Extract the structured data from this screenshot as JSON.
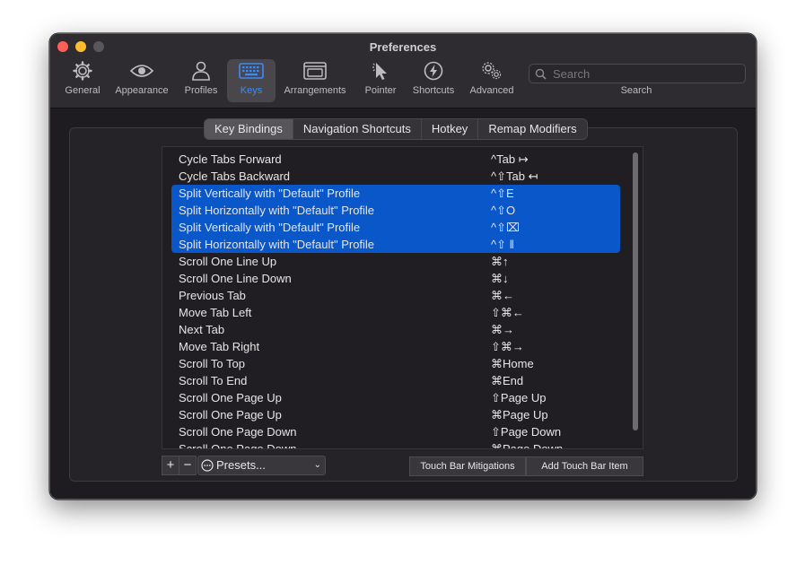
{
  "window": {
    "title": "Preferences"
  },
  "toolbar": {
    "items": [
      {
        "label": "General",
        "icon": "gear-icon"
      },
      {
        "label": "Appearance",
        "icon": "eye-icon"
      },
      {
        "label": "Profiles",
        "icon": "person-icon"
      },
      {
        "label": "Keys",
        "icon": "keyboard-icon",
        "active": true
      },
      {
        "label": "Arrangements",
        "icon": "windows-icon"
      },
      {
        "label": "Pointer",
        "icon": "pointer-icon"
      },
      {
        "label": "Shortcuts",
        "icon": "lightning-icon"
      },
      {
        "label": "Advanced",
        "icon": "gears-icon"
      }
    ],
    "search_placeholder": "Search",
    "search_label": "Search"
  },
  "tabs": [
    "Key Bindings",
    "Navigation Shortcuts",
    "Hotkey",
    "Remap Modifiers"
  ],
  "active_tab": "Key Bindings",
  "bindings": [
    {
      "action": "Cycle Tabs Forward",
      "combo": "^Tab ↦"
    },
    {
      "action": "Cycle Tabs Backward",
      "combo": "^⇧Tab ↤"
    },
    {
      "action": "Split Vertically with \"Default\" Profile",
      "combo": "^⇧E",
      "selected": true
    },
    {
      "action": "Split Horizontally with \"Default\" Profile",
      "combo": "^⇧O",
      "selected": true
    },
    {
      "action": "Split Vertically with \"Default\" Profile",
      "combo": "^⇧⌧",
      "selected": true
    },
    {
      "action": "Split Horizontally with \"Default\" Profile",
      "combo": "^⇧ ‖",
      "selected": true
    },
    {
      "action": "Scroll One Line Up",
      "combo": "⌘↑"
    },
    {
      "action": "Scroll One Line Down",
      "combo": "⌘↓"
    },
    {
      "action": "Previous Tab",
      "combo": "⌘←"
    },
    {
      "action": "Move Tab Left",
      "combo": "⇧⌘←"
    },
    {
      "action": "Next Tab",
      "combo": "⌘→"
    },
    {
      "action": "Move Tab Right",
      "combo": "⇧⌘→"
    },
    {
      "action": "Scroll To Top",
      "combo": "⌘Home"
    },
    {
      "action": "Scroll To End",
      "combo": "⌘End"
    },
    {
      "action": "Scroll One Page Up",
      "combo": "⇧Page Up"
    },
    {
      "action": "Scroll One Page Up",
      "combo": "⌘Page Up"
    },
    {
      "action": "Scroll One Page Down",
      "combo": "⇧Page Down"
    },
    {
      "action": "Scroll One Page Down",
      "combo": "⌘Page Down"
    }
  ],
  "bottom": {
    "add_label": "+",
    "remove_label": "−",
    "presets_label": "Presets...",
    "touch_bar_mitigations": "Touch Bar Mitigations",
    "add_touch_bar_item": "Add Touch Bar Item"
  },
  "colors": {
    "selection": "#0a57c9",
    "accent": "#3b8cf7"
  }
}
